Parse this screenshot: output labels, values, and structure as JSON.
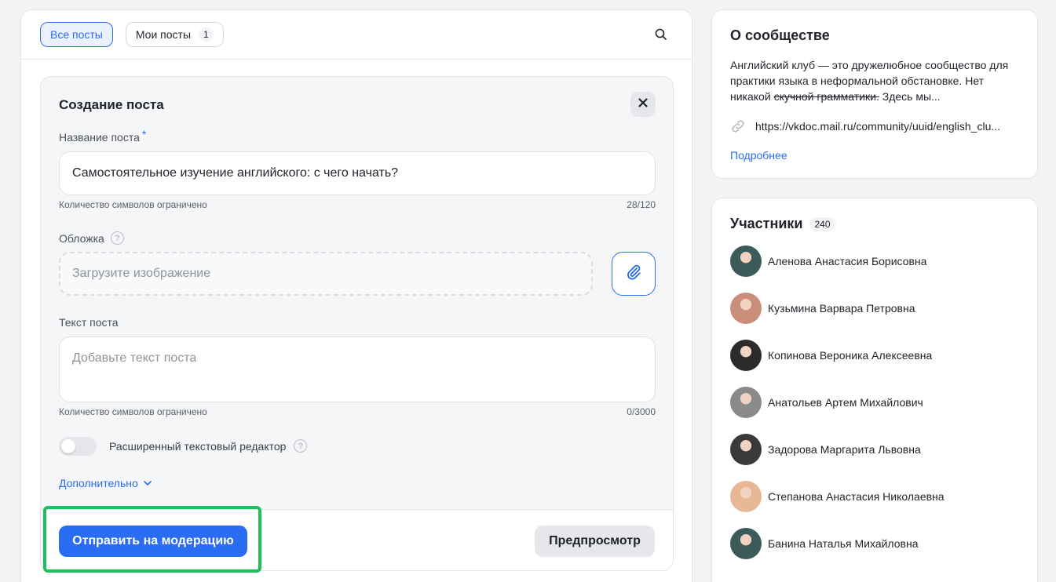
{
  "tabs": [
    {
      "label": "Все посты",
      "active": true
    },
    {
      "label": "Мои посты",
      "count": "1",
      "active": false
    }
  ],
  "create_post": {
    "title": "Создание поста",
    "name_label": "Название поста",
    "required_mark": "*",
    "name_value": "Самостоятельное изучение английского: с чего начать?",
    "name_hint": "Количество символов ограничено",
    "name_counter": "28/120",
    "cover_label": "Обложка",
    "cover_placeholder": "Загрузите изображение",
    "text_label": "Текст поста",
    "text_placeholder": "Добавьте текст поста",
    "text_hint": "Количество символов ограничено",
    "text_counter": "0/3000",
    "editor_toggle_label": "Расширенный текстовый редактор",
    "editor_toggle_on": false,
    "more_label": "Дополнительно",
    "submit_label": "Отправить на модерацию",
    "preview_label": "Предпросмотр"
  },
  "about": {
    "title": "О сообществе",
    "desc_part1": "Английский клуб — это дружелюбное сообщество для практики языка в неформальной обстановке. Нет никакой ",
    "desc_strike": "скучной грамматики.",
    "desc_part2": " Здесь мы...",
    "link": "https://vkdoc.mail.ru/community/uuid/english_clu...",
    "more_label": "Подробнее"
  },
  "members": {
    "title": "Участники",
    "count": "240",
    "list": [
      {
        "name": "Аленова Анастасия Борисовна",
        "avatar_color": "#3c5a5a"
      },
      {
        "name": "Кузьмина Варвара Петровна",
        "avatar_color": "#c98f7a"
      },
      {
        "name": "Копинова Вероника Алексеевна",
        "avatar_color": "#2b2b2b"
      },
      {
        "name": "Анатольев Артем Михайлович",
        "avatar_color": "#8a8a8a"
      },
      {
        "name": "Задорова Маргарита Львовна",
        "avatar_color": "#3a3a3a"
      },
      {
        "name": "Степанова Анастасия Николаевна",
        "avatar_color": "#e8b896"
      },
      {
        "name": "Банина Наталья Михайловна",
        "avatar_color": "#3c5a5a"
      }
    ]
  },
  "colors": {
    "accent": "#2a6cf2",
    "highlight": "#1bc15a"
  }
}
